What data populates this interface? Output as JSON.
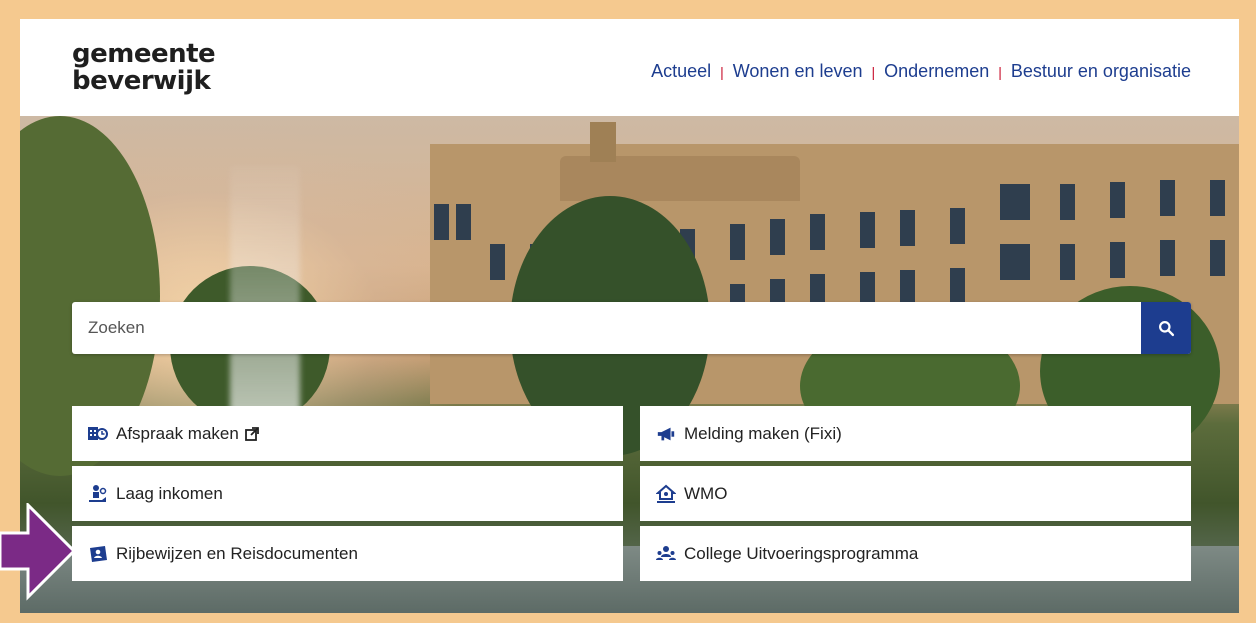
{
  "header": {
    "logo_line1": "gemeente",
    "logo_line2": "beverwijk",
    "nav": [
      {
        "label": "Actueel"
      },
      {
        "label": "Wonen en leven"
      },
      {
        "label": "Ondernemen"
      },
      {
        "label": "Bestuur en organisatie"
      }
    ]
  },
  "search": {
    "placeholder": "Zoeken",
    "value": ""
  },
  "tiles": [
    {
      "label": "Afspraak maken",
      "icon": "calendar-clock-icon",
      "external": true
    },
    {
      "label": "Melding maken (Fixi)",
      "icon": "megaphone-icon"
    },
    {
      "label": "Laag inkomen",
      "icon": "money-hand-icon"
    },
    {
      "label": "WMO",
      "icon": "house-care-icon"
    },
    {
      "label": "Rijbewijzen en Reisdocumenten",
      "icon": "id-card-icon"
    },
    {
      "label": "College Uitvoeringsprogramma",
      "icon": "people-group-icon"
    }
  ],
  "colors": {
    "brand_blue": "#1d3d8f",
    "nav_separator": "#c8102e",
    "frame": "#f5c98f",
    "annotation_arrow": "#7b2a86"
  }
}
